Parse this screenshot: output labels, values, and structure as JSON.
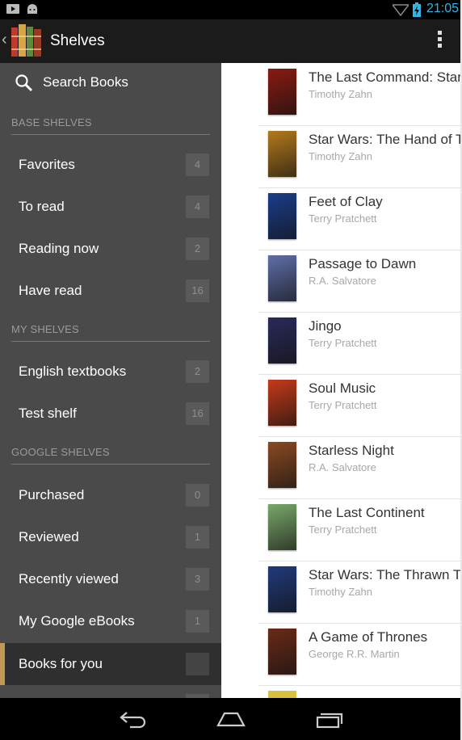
{
  "status_bar": {
    "time": "21:05"
  },
  "action_bar": {
    "title": "Shelves"
  },
  "drawer": {
    "search_label": "Search Books",
    "sections": [
      {
        "title": "BASE SHELVES",
        "items": [
          {
            "label": "Favorites",
            "count": "4"
          },
          {
            "label": "To read",
            "count": "4"
          },
          {
            "label": "Reading now",
            "count": "2"
          },
          {
            "label": "Have read",
            "count": "16"
          }
        ]
      },
      {
        "title": "MY SHELVES",
        "items": [
          {
            "label": "English textbooks",
            "count": "2"
          },
          {
            "label": "Test shelf",
            "count": "16"
          }
        ]
      },
      {
        "title": "GOOGLE SHELVES",
        "items": [
          {
            "label": "Purchased",
            "count": "0"
          },
          {
            "label": "Reviewed",
            "count": "1"
          },
          {
            "label": "Recently viewed",
            "count": "3"
          },
          {
            "label": "My Google eBooks",
            "count": "1"
          },
          {
            "label": "Books for you",
            "count": ""
          }
        ]
      }
    ],
    "selected_item": "Books for you"
  },
  "books": [
    {
      "title": "The Last Command: Star",
      "author": "Timothy Zahn",
      "cover_color": "#8a1a12"
    },
    {
      "title": "Star Wars: The Hand of T",
      "author": "Timothy Zahn",
      "cover_color": "#b47a1c"
    },
    {
      "title": "Feet of Clay",
      "author": "Terry Pratchett",
      "cover_color": "#1a3e8a"
    },
    {
      "title": "Passage to Dawn",
      "author": "R.A. Salvatore",
      "cover_color": "#5f6ea8"
    },
    {
      "title": "Jingo",
      "author": "Terry Pratchett",
      "cover_color": "#2a2a5a"
    },
    {
      "title": "Soul Music",
      "author": "Terry Pratchett",
      "cover_color": "#c43a1a"
    },
    {
      "title": "Starless Night",
      "author": "R.A. Salvatore",
      "cover_color": "#8a4a22"
    },
    {
      "title": "The Last Continent",
      "author": "Terry Pratchett",
      "cover_color": "#7aa86a"
    },
    {
      "title": "Star Wars: The Thrawn Tr",
      "author": "Timothy Zahn",
      "cover_color": "#203a7a"
    },
    {
      "title": "A Game of Thrones",
      "author": "George R.R. Martin",
      "cover_color": "#6a2a18"
    }
  ]
}
